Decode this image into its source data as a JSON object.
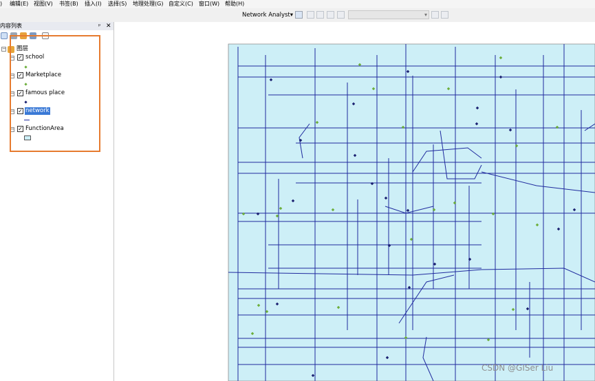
{
  "menu": [
    "编辑(E)",
    "视图(V)",
    "书签(B)",
    "插入(I)",
    "选择(S)",
    "地理处理(G)",
    "自定义(C)",
    "窗口(W)",
    "帮助(H)"
  ],
  "menu_first_glyph": ")",
  "toolbar": {
    "network_analyst": "Network Analyst▾"
  },
  "toc": {
    "title": "内容列表",
    "pin": "ᵖ",
    "close": "✕",
    "group_label": "图层",
    "layers": [
      {
        "label": "school",
        "symbol": "green-point",
        "checked": true,
        "selected": false
      },
      {
        "label": "Marketplace",
        "symbol": "green-point",
        "checked": true,
        "selected": false
      },
      {
        "label": "famous place",
        "symbol": "navy-point",
        "checked": true,
        "selected": false
      },
      {
        "label": "network",
        "symbol": "blue-line",
        "checked": true,
        "selected": true
      },
      {
        "label": "FunctionArea",
        "symbol": "light-blue-polygon",
        "checked": true,
        "selected": false
      }
    ]
  },
  "colors": {
    "map_fill": "#cdeff7",
    "road": "#1f2a9e",
    "school_point": "#6cae3b",
    "famous_point": "#1a2070",
    "highlight": "#e67a2e"
  },
  "watermark": "CSDN @GISer Liu"
}
